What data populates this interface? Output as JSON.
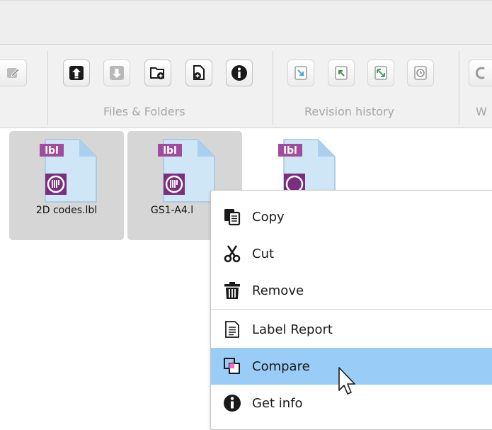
{
  "ribbon": {
    "groups": {
      "files_folders": "Files & Folders",
      "revision_history": "Revision history",
      "partial": "W"
    }
  },
  "files": [
    {
      "name": "2D codes.lbl",
      "badge": "lbl",
      "selected": true
    },
    {
      "name": "GS1-A4.l",
      "badge": "lbl",
      "selected": true
    },
    {
      "name": "",
      "badge": "lbl",
      "selected": false
    }
  ],
  "context_menu": {
    "items": [
      {
        "label": "Copy",
        "icon": "copy-icon"
      },
      {
        "label": "Cut",
        "icon": "scissors-icon"
      },
      {
        "label": "Remove",
        "icon": "trash-icon"
      },
      {
        "label": "Label Report",
        "icon": "report-icon"
      },
      {
        "label": "Compare",
        "icon": "compare-icon",
        "highlighted": true
      },
      {
        "label": "Get info",
        "icon": "info-icon"
      }
    ]
  },
  "colors": {
    "menu_highlight": "#99ccf7",
    "file_selected": "#d6d6d6",
    "label_badge": "#a14c9a",
    "ribbon_bg": "#f1f1f1"
  }
}
